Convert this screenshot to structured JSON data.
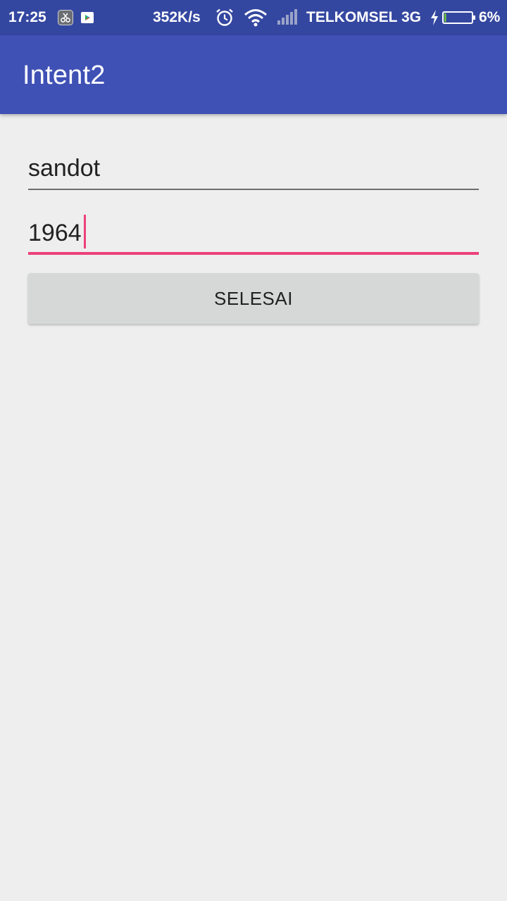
{
  "status_bar": {
    "time": "17:25",
    "app_icon_1": "scissors-app-icon",
    "app_icon_2": "play-store-icon",
    "network_speed": "352K/s",
    "alarm_icon": "alarm-icon",
    "wifi_icon": "wifi-icon",
    "signal_icon": "signal-icon",
    "carrier": "TELKOMSEL 3G",
    "charging_icon": "charging-icon",
    "battery_icon": "battery-icon",
    "battery_level": 0.06,
    "battery_percent": "6%"
  },
  "app_bar": {
    "title": "Intent2",
    "color": "#3f51b5"
  },
  "form": {
    "name_value": "sandot",
    "year_value": "1964",
    "focus_color": "#ec407a",
    "submit_label": "SELESAI"
  }
}
